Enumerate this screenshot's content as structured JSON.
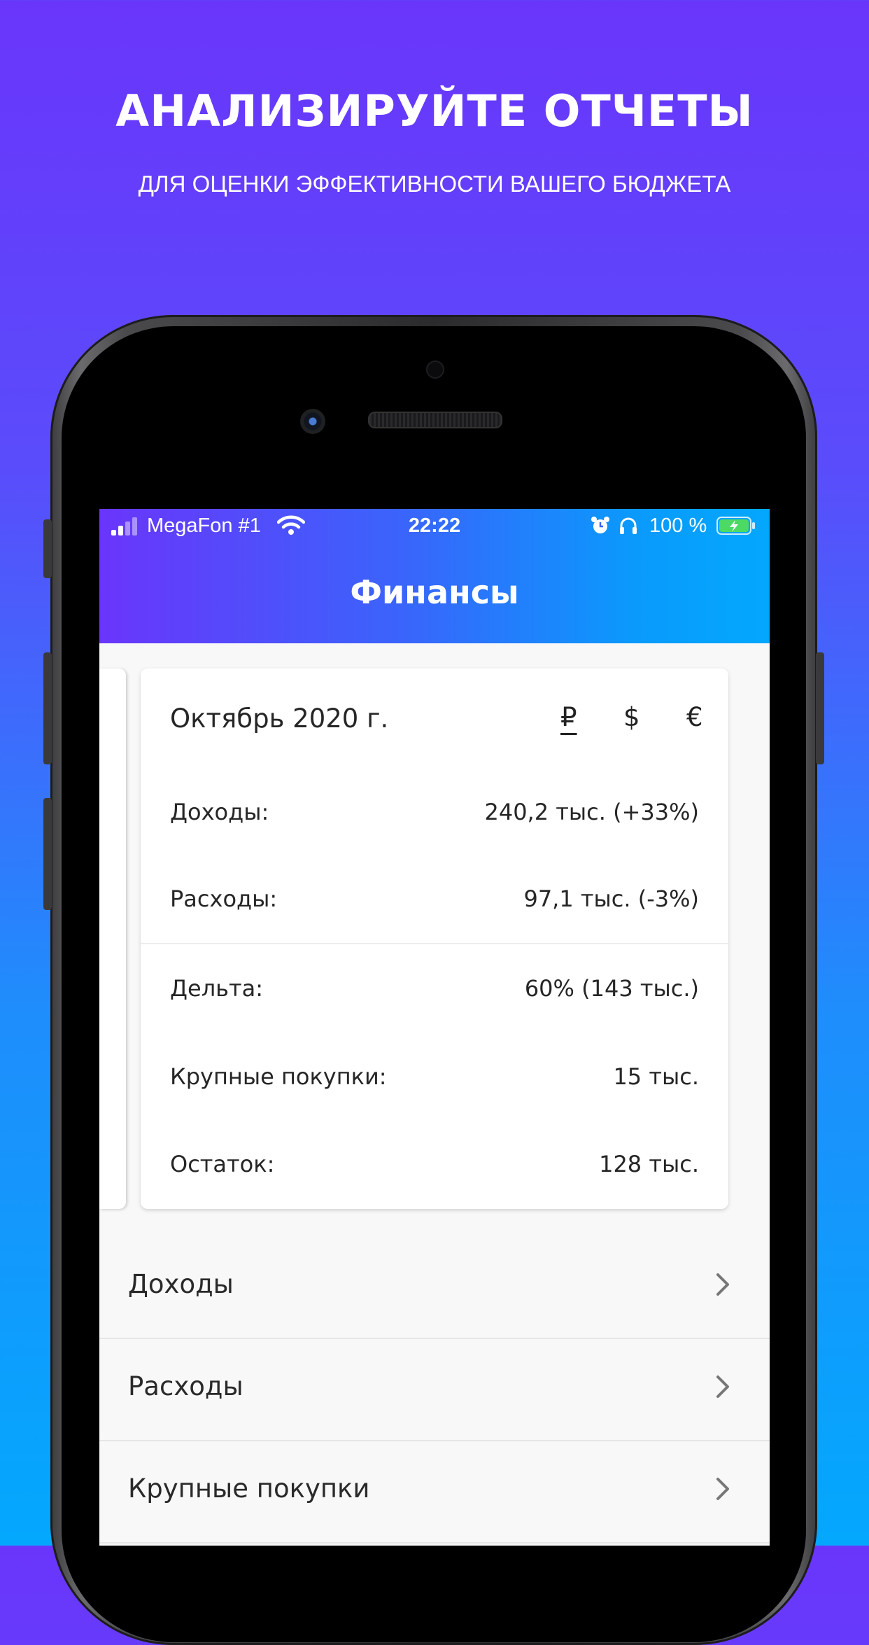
{
  "promo": {
    "title": "АНАЛИЗИРУЙТЕ ОТЧЕТЫ",
    "subtitle": "ДЛЯ ОЦЕНКИ ЭФФЕКТИВНОСТИ ВАШЕГО БЮДЖЕТА"
  },
  "status_bar": {
    "carrier": "MegaFon #1",
    "time": "22:22",
    "battery": "100 %",
    "icons": [
      "signal-icon",
      "wifi-icon",
      "alarm-icon",
      "headphones-icon",
      "battery-charging-icon"
    ]
  },
  "header": {
    "title": "Финансы"
  },
  "summary": {
    "month": "Октябрь 2020 г.",
    "currencies": [
      "₽",
      "$",
      "€"
    ],
    "active_currency": "₽",
    "rows": [
      {
        "label": "Доходы:",
        "value": "240,2 тыс. (+33%)"
      },
      {
        "label": "Расходы:",
        "value": "97,1 тыс. (-3%)"
      },
      {
        "label": "Дельта:",
        "value": "60% (143 тыс.)"
      },
      {
        "label": "Крупные покупки:",
        "value": "15 тыс."
      },
      {
        "label": "Остаток:",
        "value": "128 тыс."
      }
    ]
  },
  "menu": [
    {
      "label": "Доходы",
      "icon": "chevron-right-icon"
    },
    {
      "label": "Расходы",
      "icon": "chevron-right-icon"
    },
    {
      "label": "Крупные покупки",
      "icon": "chevron-right-icon"
    }
  ],
  "colors": {
    "gradient_top": "#6a35fb",
    "gradient_bottom": "#03a8fd",
    "header_left": "#6a35fb",
    "header_right": "#03a8fd",
    "battery_green": "#4cd964"
  }
}
